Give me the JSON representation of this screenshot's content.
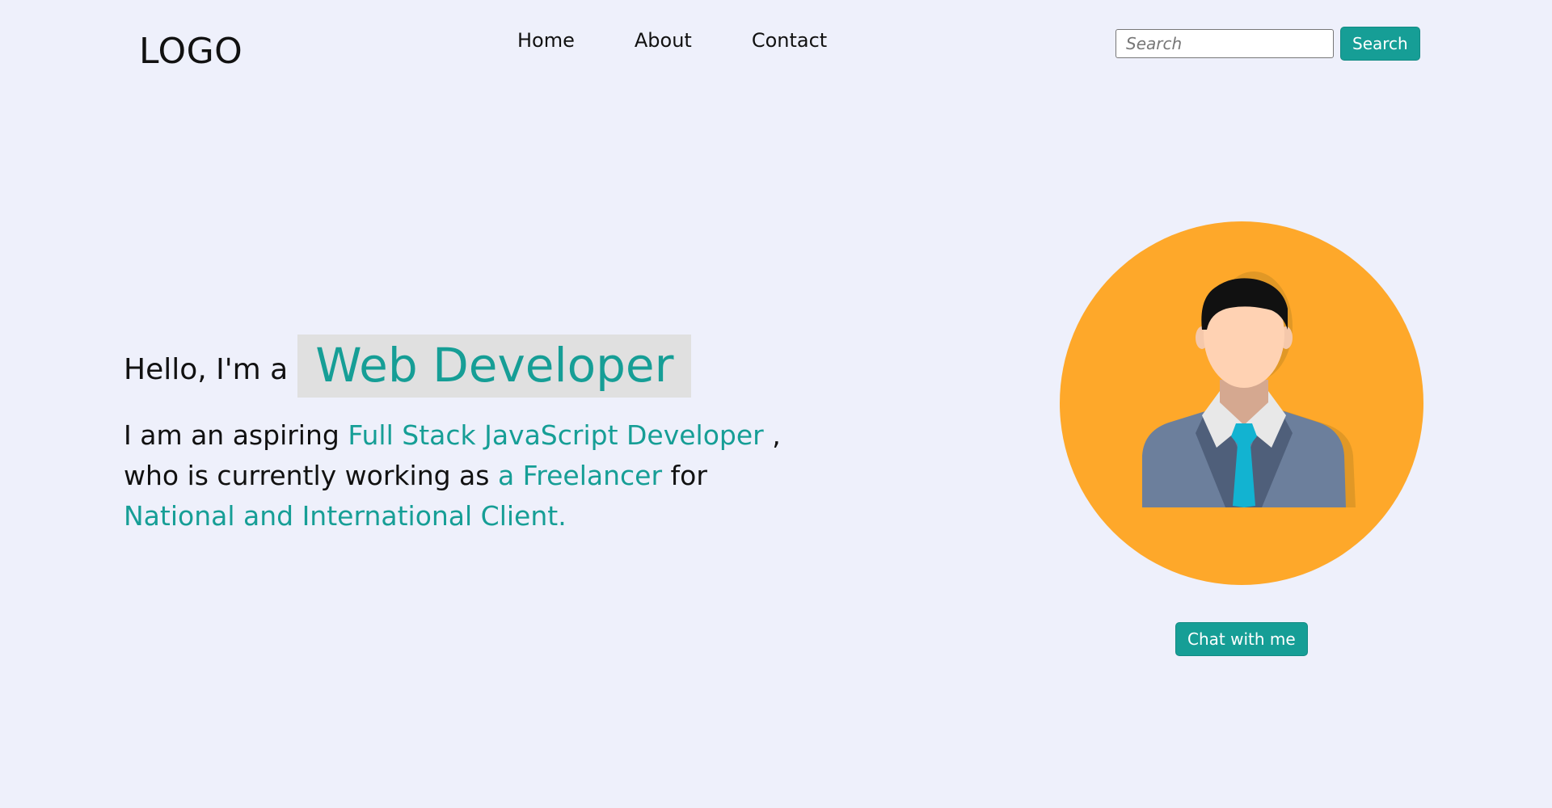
{
  "header": {
    "logo": "LOGO",
    "nav": [
      {
        "label": "Home"
      },
      {
        "label": "About"
      },
      {
        "label": "Contact"
      }
    ],
    "search": {
      "placeholder": "Search",
      "value": "",
      "button_label": "Search"
    }
  },
  "hero": {
    "greeting": "Hello, I'm a",
    "role": "Web Developer",
    "intro": {
      "part1": "I am an aspiring ",
      "highlight1": "Full Stack JavaScript Developer",
      "part2": " ,",
      "part3": "who is currently working as ",
      "highlight2": "a Freelancer",
      "part4": " for",
      "highlight3": "National and International Client."
    }
  },
  "profile": {
    "avatar_icon": "businessman-avatar-icon",
    "chat_button_label": "Chat with me"
  },
  "colors": {
    "accent": "#169e96",
    "background": "#eef0fb",
    "avatar_circle": "#fea82a",
    "role_box": "#e0e0e0"
  }
}
